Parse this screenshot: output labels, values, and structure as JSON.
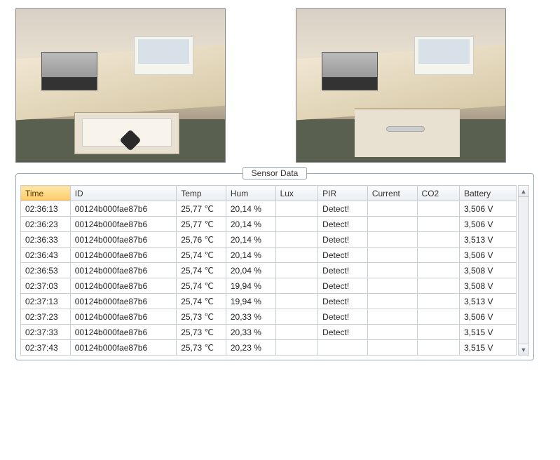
{
  "photos": {
    "left_alt": "Lab desk with equipment, laptop, and open drawer containing sensor node",
    "right_alt": "Lab desk with equipment and laptop, drawer closed"
  },
  "panel": {
    "title": "Sensor Data"
  },
  "table": {
    "headers": {
      "time": "Time",
      "id": "ID",
      "temp": "Temp",
      "hum": "Hum",
      "lux": "Lux",
      "pir": "PIR",
      "current": "Current",
      "co2": "CO2",
      "battery": "Battery"
    },
    "rows": [
      {
        "time": "02:36:13",
        "id": "00124b000fae87b6",
        "temp": "25,77 ℃",
        "hum": "20,14 %",
        "lux": "",
        "pir": "Detect!",
        "current": "",
        "co2": "",
        "battery": "3,506 V"
      },
      {
        "time": "02:36:23",
        "id": "00124b000fae87b6",
        "temp": "25,77 ℃",
        "hum": "20,14 %",
        "lux": "",
        "pir": "Detect!",
        "current": "",
        "co2": "",
        "battery": "3,506 V"
      },
      {
        "time": "02:36:33",
        "id": "00124b000fae87b6",
        "temp": "25,76 ℃",
        "hum": "20,14 %",
        "lux": "",
        "pir": "Detect!",
        "current": "",
        "co2": "",
        "battery": "3,513 V"
      },
      {
        "time": "02:36:43",
        "id": "00124b000fae87b6",
        "temp": "25,74 ℃",
        "hum": "20,14 %",
        "lux": "",
        "pir": "Detect!",
        "current": "",
        "co2": "",
        "battery": "3,506 V"
      },
      {
        "time": "02:36:53",
        "id": "00124b000fae87b6",
        "temp": "25,74 ℃",
        "hum": "20,04 %",
        "lux": "",
        "pir": "Detect!",
        "current": "",
        "co2": "",
        "battery": "3,508 V"
      },
      {
        "time": "02:37:03",
        "id": "00124b000fae87b6",
        "temp": "25,74 ℃",
        "hum": "19,94 %",
        "lux": "",
        "pir": "Detect!",
        "current": "",
        "co2": "",
        "battery": "3,508 V"
      },
      {
        "time": "02:37:13",
        "id": "00124b000fae87b6",
        "temp": "25,74 ℃",
        "hum": "19,94 %",
        "lux": "",
        "pir": "Detect!",
        "current": "",
        "co2": "",
        "battery": "3,513 V"
      },
      {
        "time": "02:37:23",
        "id": "00124b000fae87b6",
        "temp": "25,73 ℃",
        "hum": "20,33 %",
        "lux": "",
        "pir": "Detect!",
        "current": "",
        "co2": "",
        "battery": "3,506 V"
      },
      {
        "time": "02:37:33",
        "id": "00124b000fae87b6",
        "temp": "25,73 ℃",
        "hum": "20,33 %",
        "lux": "",
        "pir": "Detect!",
        "current": "",
        "co2": "",
        "battery": "3,515 V"
      },
      {
        "time": "02:37:43",
        "id": "00124b000fae87b6",
        "temp": "25,73 ℃",
        "hum": "20,23 %",
        "lux": "",
        "pir": "",
        "current": "",
        "co2": "",
        "battery": "3,515 V"
      }
    ]
  },
  "scroll": {
    "up": "▲",
    "down": "▼"
  }
}
